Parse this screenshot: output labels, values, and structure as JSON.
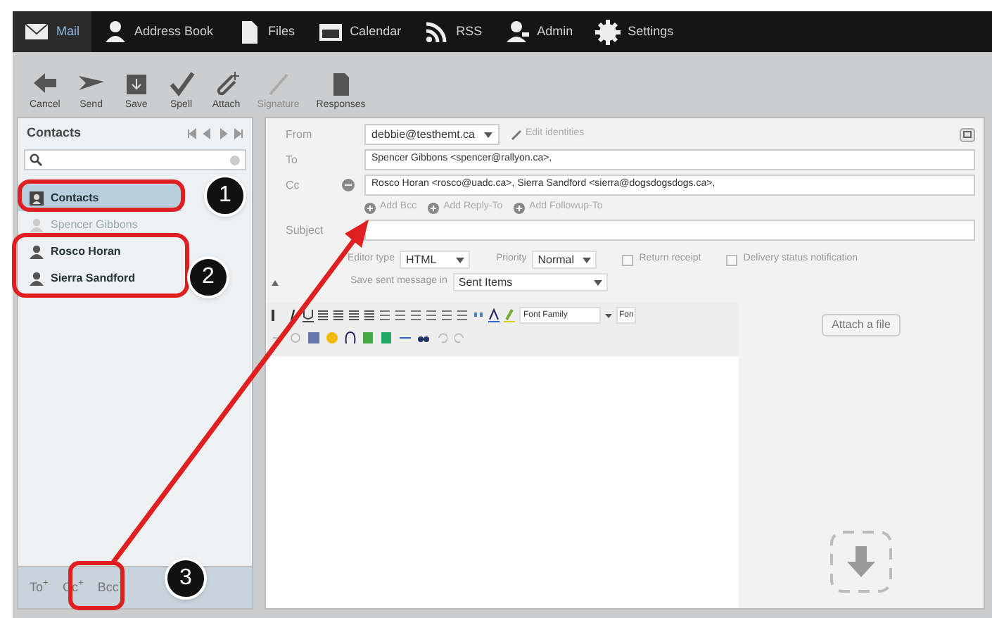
{
  "nav": [
    {
      "label": "Mail",
      "selected": true
    },
    {
      "label": "Address Book",
      "selected": false
    },
    {
      "label": "Files",
      "selected": false
    },
    {
      "label": "Calendar",
      "selected": false
    },
    {
      "label": "RSS",
      "selected": false
    },
    {
      "label": "Admin",
      "selected": false
    },
    {
      "label": "Settings",
      "selected": false
    }
  ],
  "toolbar": [
    {
      "label": "Cancel",
      "disabled": false
    },
    {
      "label": "Send",
      "disabled": false
    },
    {
      "label": "Save",
      "disabled": false
    },
    {
      "label": "Spell",
      "disabled": false
    },
    {
      "label": "Attach",
      "disabled": false
    },
    {
      "label": "Signature",
      "disabled": true
    },
    {
      "label": "Responses",
      "disabled": false
    }
  ],
  "contacts": {
    "title": "Contacts",
    "items": [
      {
        "name": "Contacts",
        "kind": "group",
        "selected": true,
        "dimmed": false
      },
      {
        "name": "Spencer Gibbons",
        "kind": "contact",
        "selected": false,
        "dimmed": true
      },
      {
        "name": "Rosco Horan",
        "kind": "contact",
        "selected": false,
        "dimmed": false
      },
      {
        "name": "Sierra Sandford",
        "kind": "contact",
        "selected": false,
        "dimmed": false
      }
    ],
    "footer": [
      "To$^{+}$",
      "Cc$^{+}$",
      "Bcc$^{+}$"
    ]
  },
  "compose": {
    "from": {
      "label": "From",
      "value": "debbie@testhemt.ca",
      "edit": "Edit identities"
    },
    "to": {
      "label": "To",
      "value": "Spencer Gibbons <spencer@rallyon.ca>,"
    },
    "cc": {
      "label": "Cc",
      "value": "Rosco Horan <rosco@uadc.ca>,  Sierra Sandford <sierra@dogsdogsdogs.ca>,"
    },
    "add_links": [
      "Add Bcc",
      "Add Reply-To",
      "Add Followup-To"
    ],
    "subject": {
      "label": "Subject"
    },
    "editor_type": {
      "label": "Editor type",
      "value": "HTML"
    },
    "priority": {
      "label": "Priority",
      "value": "Normal"
    },
    "checkboxes": [
      {
        "label": "Return receipt",
        "checked": false
      },
      {
        "label": "Delivery status notification",
        "checked": false
      }
    ],
    "save_sent": {
      "label": "Save sent message in",
      "value": "Sent Items"
    },
    "font_family": "Font Family",
    "font_size": "Fon",
    "attach_button": "Attach a file"
  },
  "callouts": [
    "1",
    "2",
    "3"
  ]
}
